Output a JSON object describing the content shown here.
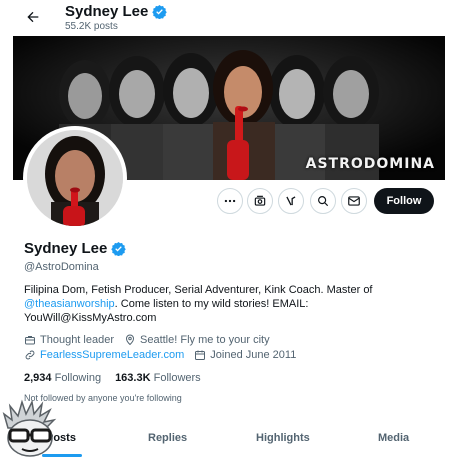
{
  "header": {
    "name": "Sydney Lee",
    "post_count": "55.2K posts"
  },
  "banner": {
    "brand_text": "ASTRODOMINA"
  },
  "actions": {
    "follow_label": "Follow",
    "icons": [
      "more-icon",
      "subscribe-icon",
      "grok-icon",
      "search-icon",
      "message-icon"
    ]
  },
  "profile": {
    "display_name": "Sydney Lee",
    "handle": "@AstroDomina",
    "bio_part1": "Filipina Dom, Fetish Producer, Serial Adventurer, Kink Coach. Master of ",
    "bio_mention": "@theasianworship",
    "bio_part2": ". Come listen to my wild stories! EMAIL: YouWill@KissMyAstro.com",
    "category": "Thought leader",
    "location": "Seattle! Fly me to your city",
    "website": "FearlessSupremeLeader.com",
    "joined": "Joined June 2011",
    "following_count": "2,934",
    "following_label": "Following",
    "followers_count": "163.3K",
    "followers_label": "Followers",
    "not_followed": "Not followed by anyone you're following"
  },
  "tabs": [
    {
      "label": "Posts",
      "active": true
    },
    {
      "label": "Replies",
      "active": false
    },
    {
      "label": "Highlights",
      "active": false
    },
    {
      "label": "Media",
      "active": false
    }
  ],
  "colors": {
    "accent": "#1d9bf0",
    "text": "#0f1419",
    "muted": "#536471",
    "verified": "#1d9bf0",
    "follow_button": "#0f1419"
  }
}
